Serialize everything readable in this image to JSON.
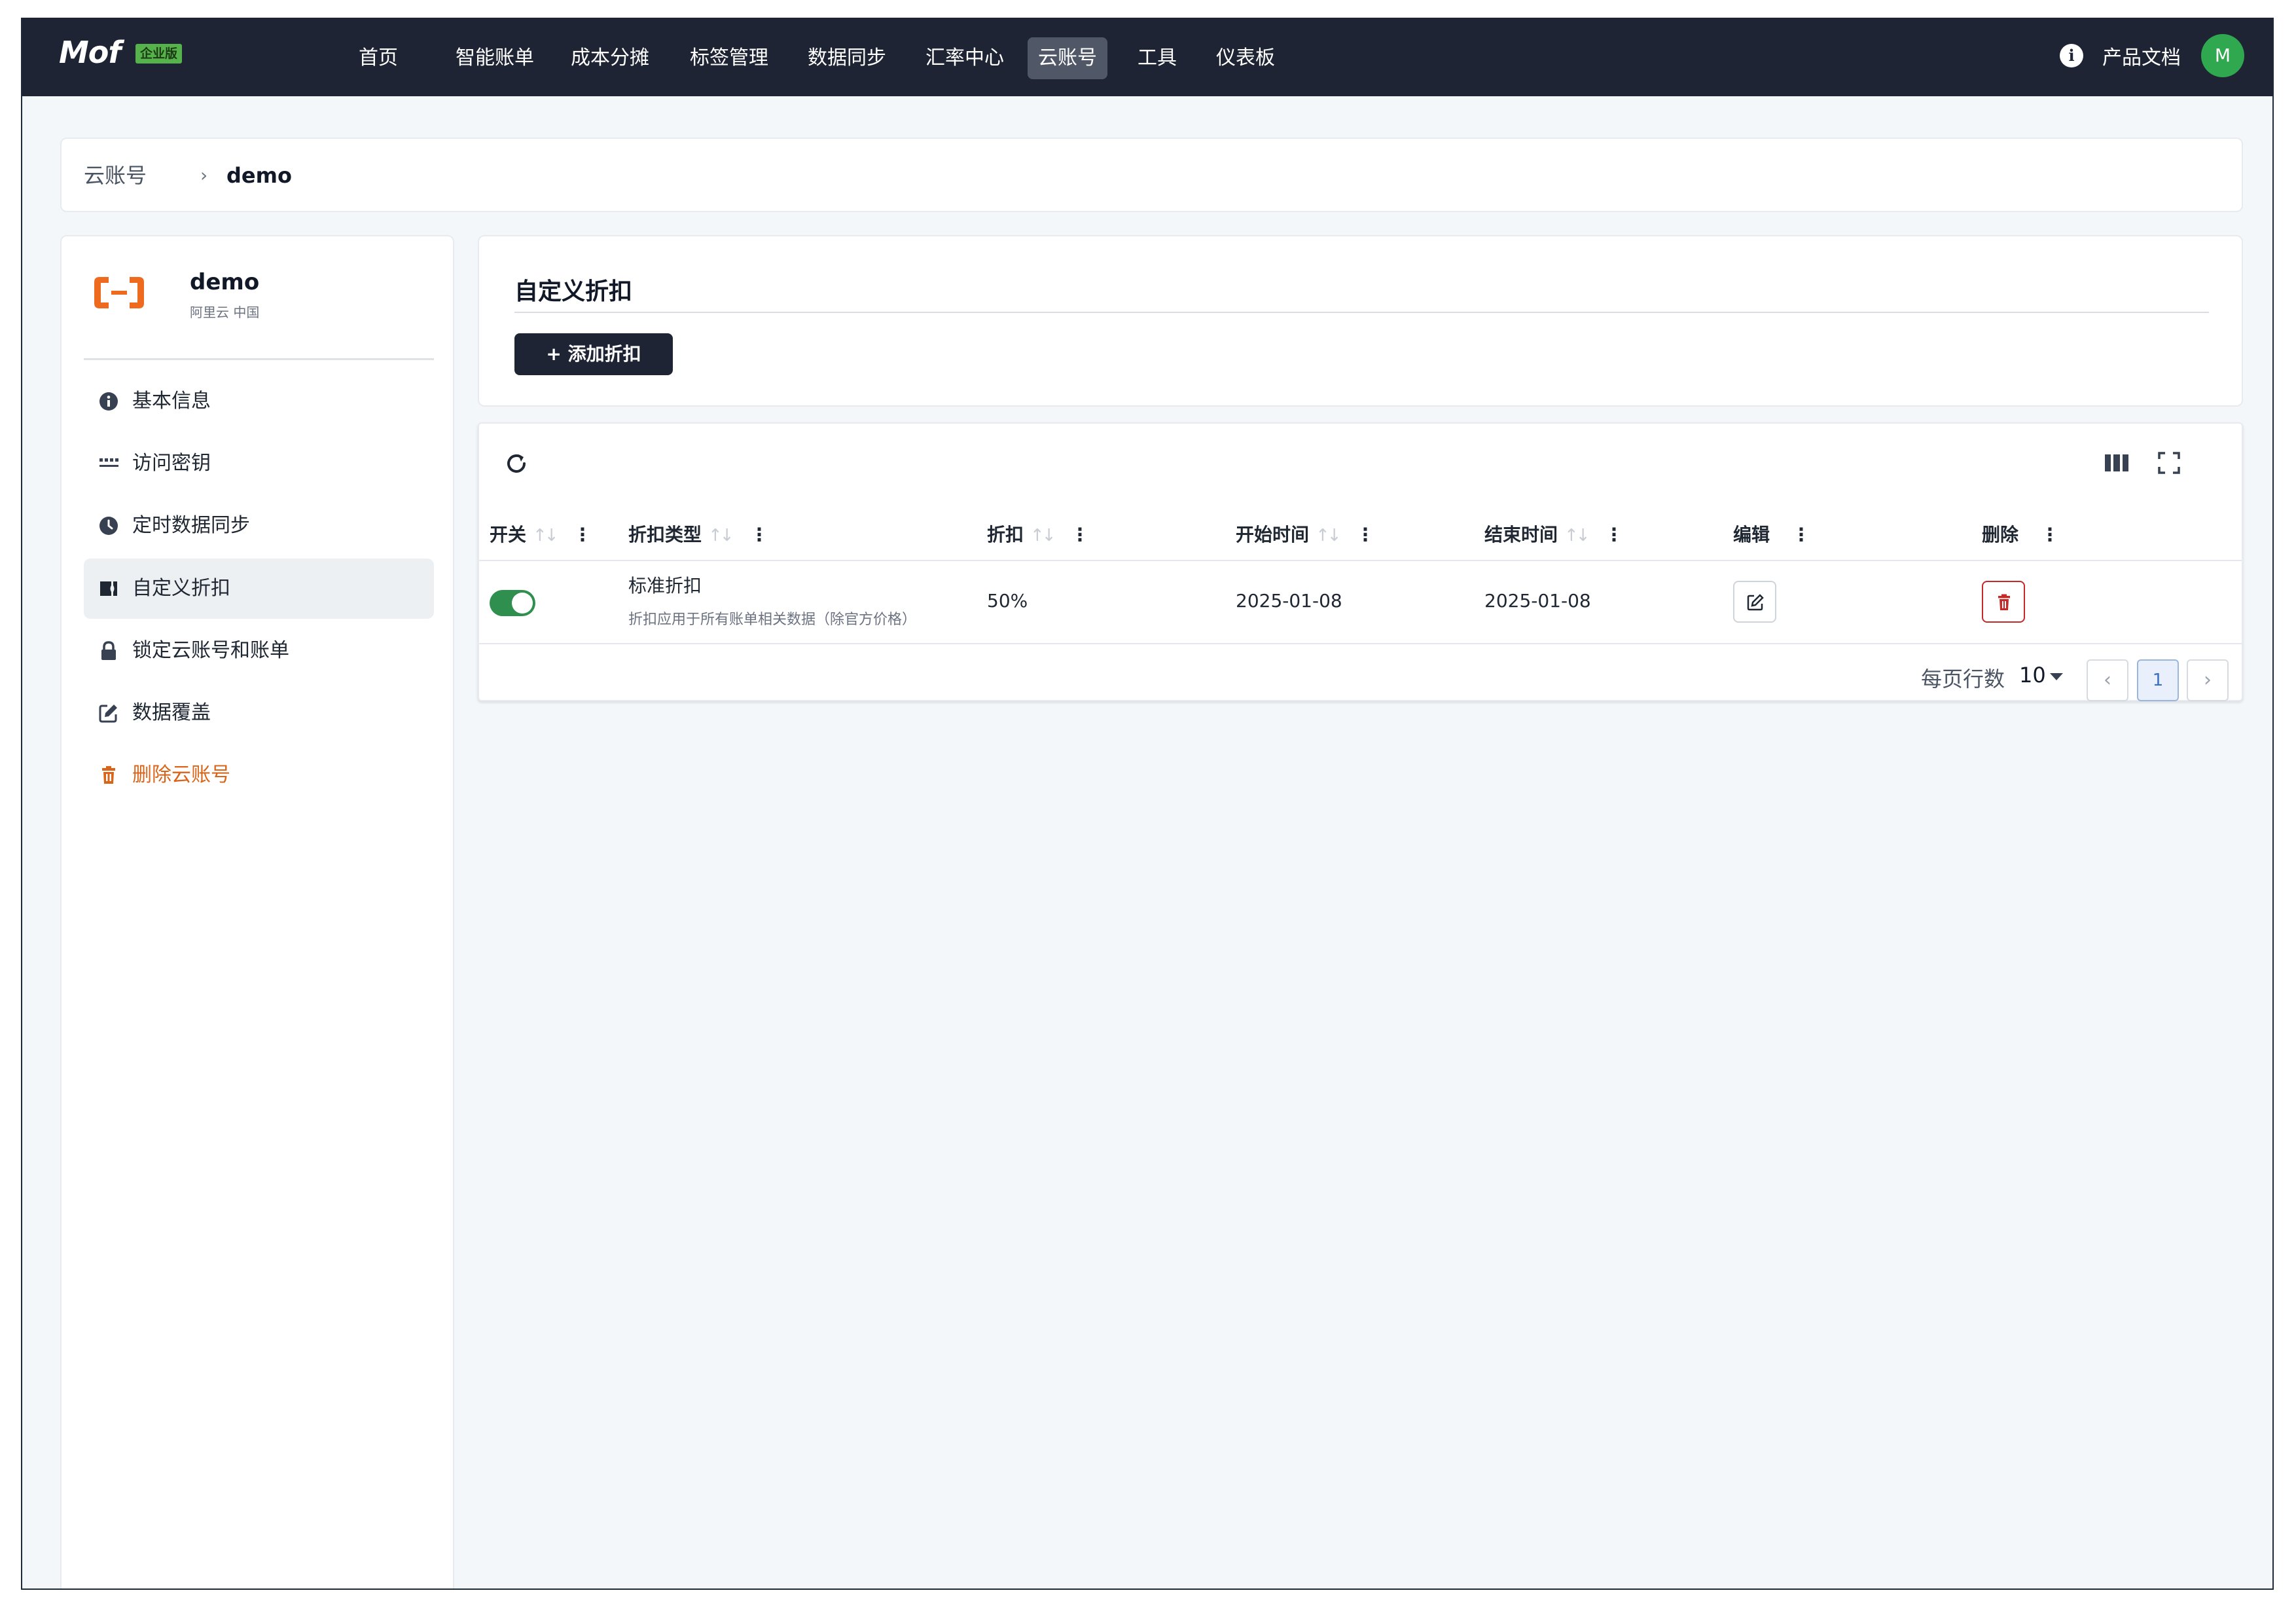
{
  "navbar": {
    "logo": "Mof",
    "edition_badge": "企业版",
    "items": [
      {
        "label": "首页"
      },
      {
        "label": "智能账单"
      },
      {
        "label": "成本分摊"
      },
      {
        "label": "标签管理"
      },
      {
        "label": "数据同步"
      },
      {
        "label": "汇率中心"
      },
      {
        "label": "云账号",
        "active": true
      },
      {
        "label": "工具"
      },
      {
        "label": "仪表板"
      }
    ],
    "docs_label": "产品文档",
    "avatar_initial": "M",
    "colors": {
      "background": "#1e2434",
      "active_item": "#505868",
      "avatar": "#2fa84f"
    }
  },
  "breadcrumb": {
    "root": "云账号",
    "separator": "›",
    "current": "demo"
  },
  "sidebar": {
    "account_name": "demo",
    "account_provider": "阿里云 中国",
    "provider_icon": "alibaba-cloud-logo",
    "items": [
      {
        "label": "基本信息",
        "icon": "info-icon"
      },
      {
        "label": "访问密钥",
        "icon": "key-dots-icon"
      },
      {
        "label": "定时数据同步",
        "icon": "clock-icon"
      },
      {
        "label": "自定义折扣",
        "icon": "ticket-icon",
        "active": true
      },
      {
        "label": "锁定云账号和账单",
        "icon": "lock-icon"
      },
      {
        "label": "数据覆盖",
        "icon": "edit-icon"
      },
      {
        "label": "删除云账号",
        "icon": "trash-icon",
        "danger": true
      }
    ]
  },
  "main": {
    "title": "自定义折扣",
    "add_button": "+ 添加折扣",
    "table": {
      "columns": [
        {
          "label": "开关",
          "sortable": true
        },
        {
          "label": "折扣类型",
          "sortable": true
        },
        {
          "label": "折扣",
          "sortable": true
        },
        {
          "label": "开始时间",
          "sortable": true
        },
        {
          "label": "结束时间",
          "sortable": true
        },
        {
          "label": "编辑",
          "sortable": false
        },
        {
          "label": "删除",
          "sortable": false
        }
      ],
      "sort_glyph": "↑↓",
      "menu_glyph": "⋮",
      "rows": [
        {
          "enabled": true,
          "type": "标准折扣",
          "type_desc": "折扣应用于所有账单相关数据（除官方价格）",
          "discount": "50%",
          "start": "2025-01-08",
          "end": "2025-01-08"
        }
      ]
    },
    "pagination": {
      "rows_per_page_label": "每页行数",
      "rows_per_page": "10",
      "prev": "‹",
      "current_page": "1",
      "next": "›"
    }
  }
}
